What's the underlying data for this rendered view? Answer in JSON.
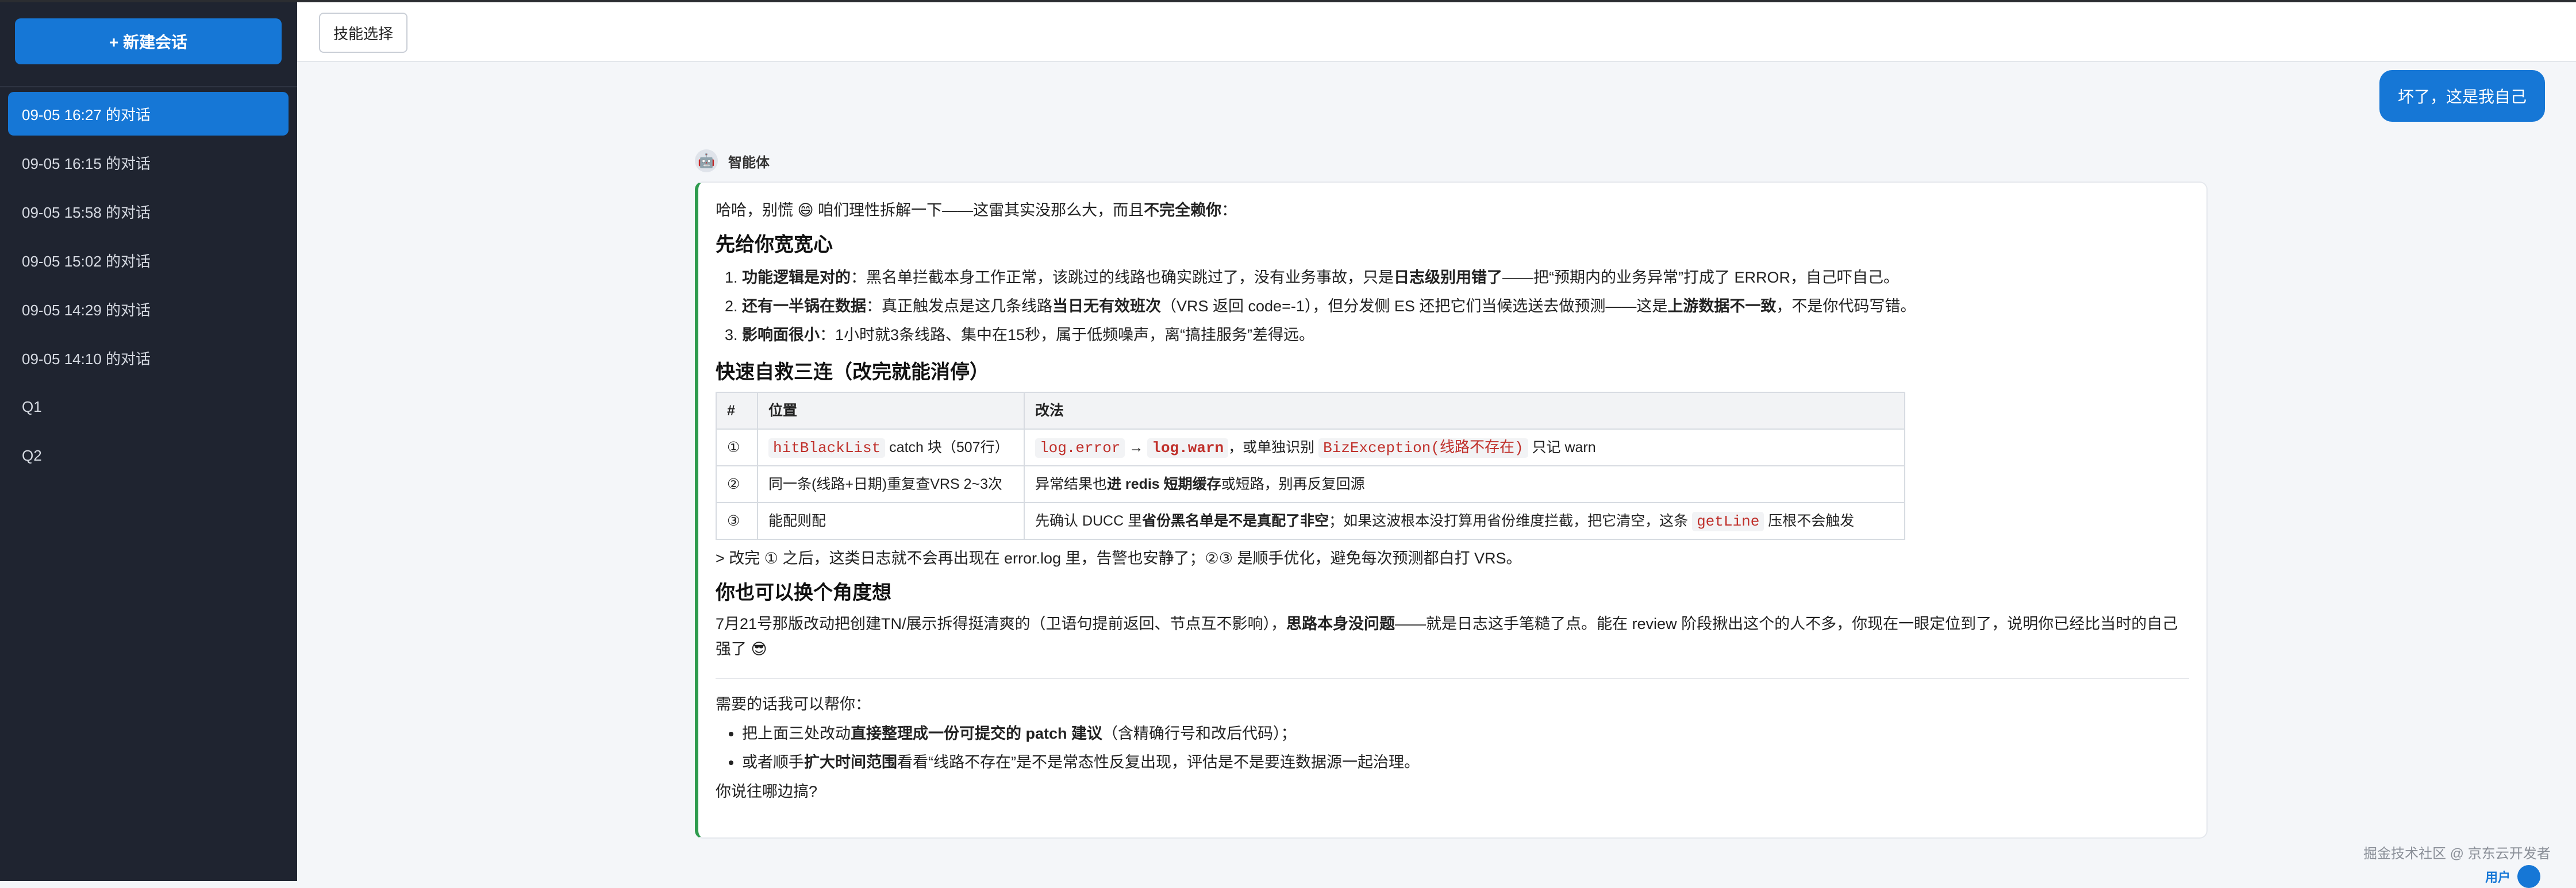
{
  "sidebar": {
    "new_chat_label": "+ 新建会话",
    "conversations": [
      {
        "label": "09-05 16:27 的对话"
      },
      {
        "label": "09-05 16:15 的对话"
      },
      {
        "label": "09-05 15:58 的对话"
      },
      {
        "label": "09-05 15:02 的对话"
      },
      {
        "label": "09-05 14:29 的对话"
      },
      {
        "label": "09-05 14:10 的对话"
      },
      {
        "label": "Q1"
      },
      {
        "label": "Q2"
      }
    ]
  },
  "toolbar": {
    "skill_label": "技能选择"
  },
  "user_message": "坏了，这是我自己",
  "agent": {
    "name": "智能体",
    "intro_a": "哈哈，别慌 😄 咱们理性拆解一下——这雷其实没那么大，而且",
    "intro_b": "不完全赖你",
    "intro_c": "：",
    "sec1_title": "先给你宽宽心",
    "li1_b": "功能逻辑是对的",
    "li1_t1": "：黑名单拦截本身工作正常，该跳过的线路也确实跳过了，没有业务事故，只是",
    "li1_b2": "日志级别用错了",
    "li1_t2": "——把“预期内的业务异常”打成了 ERROR，自己吓自己。",
    "li2_b": "还有一半锅在数据",
    "li2_t1": "：真正触发点是这几条线路",
    "li2_b2": "当日无有效班次",
    "li2_t2": "（VRS 返回 code=-1），但分发侧 ES 还把它们当候选送去做预测——这是",
    "li2_b3": "上游数据不一致",
    "li2_t3": "，不是你代码写错。",
    "li3_b": "影响面很小",
    "li3_t": "：1小时就3条线路、集中在15秒，属于低频噪声，离“搞挂服务”差得远。",
    "sec2_title": "快速自救三连（改完就能消停）",
    "table": {
      "headers": [
        "#",
        "位置",
        "改法"
      ],
      "r1": {
        "n": "①",
        "code1": "hitBlackList",
        "loc_t": " catch 块（507行）",
        "c1": "log.error",
        "arrow": " → ",
        "c2": "log.warn",
        "t1": "，或单独识别 ",
        "c3": "BizException(线路不存在)",
        "t2": " 只记 warn"
      },
      "r2": {
        "n": "②",
        "loc": "同一条(线路+日期)重复查VRS 2~3次",
        "t1": "异常结果也",
        "b1": "进 redis 短期缓存",
        "t2": "或短路，别再反复回源"
      },
      "r3": {
        "n": "③",
        "loc": "能配则配",
        "t1": "先确认 DUCC 里",
        "b1": "省份黑名单是不是真配了非空",
        "t2": "；如果这波根本没打算用省份维度拦截，把它清空，这条 ",
        "code": "getLine",
        "t3": " 压根不会触发"
      }
    },
    "quote": "> 改完 ① 之后，这类日志就不会再出现在 error.log 里，告警也安静了；②③ 是顺手优化，避免每次预测都白打 VRS。",
    "sec3_title": "你也可以换个角度想",
    "para_t1": "7月21号那版改动把创建TN/展示拆得挺清爽的（卫语句提前返回、节点互不影响），",
    "para_b": "思路本身没问题",
    "para_t2": "——就是日志这手笔糙了点。能在 review 阶段揪出这个的人不多，你现在一眼定位到了，说明你已经比当时的自己强了 😎",
    "help_intro": "需要的话我可以帮你：",
    "help1_t1": "把上面三处改动",
    "help1_b": "直接整理成一份可提交的 patch 建议",
    "help1_t2": "（含精确行号和改后代码）；",
    "help2_t1": "或者顺手",
    "help2_b": "扩大时间范围",
    "help2_t2": "看看“线路不存在”是不是常态性反复出现，评估是不是要连数据源一起治理。",
    "closing": "你说往哪边搞?"
  },
  "footer": {
    "watermark": "掘金技术社区 @ 京东云开发者",
    "user_label": "用户"
  }
}
